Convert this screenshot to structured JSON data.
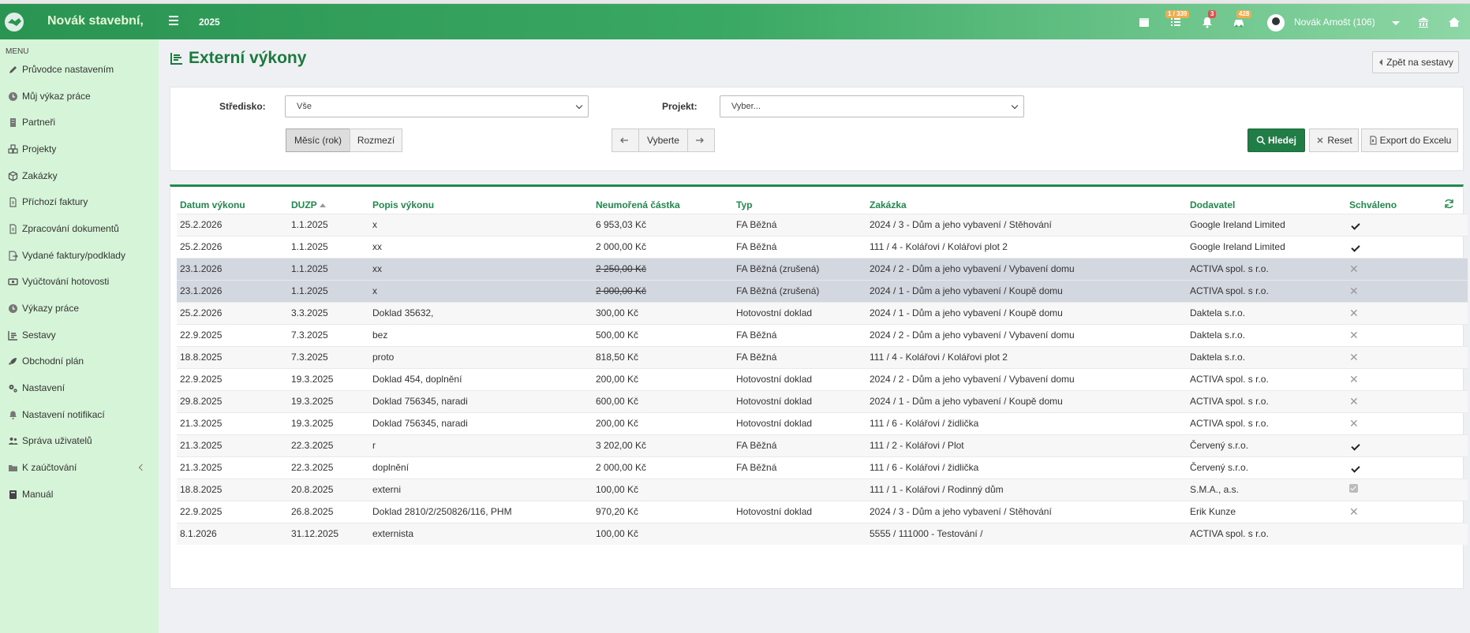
{
  "header": {
    "brand": "Novák stavební,",
    "year": "2025",
    "badges": {
      "tasks": "1 / 339",
      "notifications": "3",
      "cars": "428"
    },
    "user": "Novák Arnošt (106)"
  },
  "sidebar": {
    "menu_title": "MENU",
    "items": [
      {
        "label": "Průvodce nastavením",
        "icon": "pencil-icon"
      },
      {
        "label": "Můj výkaz práce",
        "icon": "clock-icon"
      },
      {
        "label": "Partneři",
        "icon": "building-icon"
      },
      {
        "label": "Projekty",
        "icon": "cubes-icon"
      },
      {
        "label": "Zakázky",
        "icon": "cube-icon"
      },
      {
        "label": "Příchozí faktury",
        "icon": "document-icon"
      },
      {
        "label": "Zpracování dokumentů",
        "icon": "document-icon"
      },
      {
        "label": "Vydané faktury/podklady",
        "icon": "export-icon"
      },
      {
        "label": "Vyúčtování hotovosti",
        "icon": "money-icon"
      },
      {
        "label": "Výkazy práce",
        "icon": "clock-icon"
      },
      {
        "label": "Sestavy",
        "icon": "report-icon"
      },
      {
        "label": "Obchodní plán",
        "icon": "rocket-icon"
      },
      {
        "label": "Nastavení",
        "icon": "gears-icon"
      },
      {
        "label": "Nastavení notifikací",
        "icon": "bell-icon"
      },
      {
        "label": "Správa uživatelů",
        "icon": "users-icon"
      },
      {
        "label": "K zaúčtování",
        "icon": "folder-icon"
      },
      {
        "label": "Manuál",
        "icon": "book-icon"
      }
    ]
  },
  "page": {
    "title": "Externí výkony",
    "back_button": "Zpět na sestavy"
  },
  "filters": {
    "stredisko_label": "Středisko:",
    "stredisko_value": "Vše",
    "projekt_label": "Projekt:",
    "projekt_placeholder": "Vyber...",
    "mode_month": "Měsíc (rok)",
    "mode_range": "Rozmezí",
    "period_select": "Vyberte",
    "search_button": "Hledej",
    "reset_button": "Reset",
    "export_button": "Export do Excelu"
  },
  "table": {
    "columns": [
      "Datum výkonu",
      "DUZP",
      "Popis výkonu",
      "Neumořená částka",
      "Typ",
      "Zakázka",
      "Dodavatel",
      "Schváleno"
    ],
    "rows": [
      {
        "datum": "25.2.2026",
        "duzp": "1.1.2025",
        "popis": "x",
        "castka": "6 953,03 Kč",
        "typ": "FA Běžná",
        "zakazka": "2024 / 3 - Dům a jeho vybavení / Stěhování",
        "dodavatel": "Google Ireland Limited",
        "schvaleno": "check",
        "cancelled": false
      },
      {
        "datum": "25.2.2026",
        "duzp": "1.1.2025",
        "popis": "xx",
        "castka": "2 000,00 Kč",
        "typ": "FA Běžná",
        "zakazka": "111 / 4 - Kolářovi / Kolářovi plot 2",
        "dodavatel": "Google Ireland Limited",
        "schvaleno": "check",
        "cancelled": false
      },
      {
        "datum": "23.1.2026",
        "duzp": "1.1.2025",
        "popis": "xx",
        "castka": "2 250,00 Kč",
        "typ": "FA Běžná (zrušená)",
        "zakazka": "2024 / 2 - Dům a jeho vybavení / Vybavení domu",
        "dodavatel": "ACTIVA spol. s r.o.",
        "schvaleno": "x",
        "cancelled": true
      },
      {
        "datum": "23.1.2026",
        "duzp": "1.1.2025",
        "popis": "x",
        "castka": "2 000,00 Kč",
        "typ": "FA Běžná (zrušená)",
        "zakazka": "2024 / 1 - Dům a jeho vybavení / Koupě domu",
        "dodavatel": "ACTIVA spol. s r.o.",
        "schvaleno": "x",
        "cancelled": true
      },
      {
        "datum": "25.2.2026",
        "duzp": "3.3.2025",
        "popis": "Doklad 35632,",
        "castka": "300,00 Kč",
        "typ": "Hotovostní doklad",
        "zakazka": "2024 / 1 - Dům a jeho vybavení / Koupě domu",
        "dodavatel": "Daktela s.r.o.",
        "schvaleno": "x",
        "cancelled": false
      },
      {
        "datum": "22.9.2025",
        "duzp": "7.3.2025",
        "popis": "bez",
        "castka": "500,00 Kč",
        "typ": "FA Běžná",
        "zakazka": "2024 / 2 - Dům a jeho vybavení / Vybavení domu",
        "dodavatel": "Daktela s.r.o.",
        "schvaleno": "x",
        "cancelled": false
      },
      {
        "datum": "18.8.2025",
        "duzp": "7.3.2025",
        "popis": "proto",
        "castka": "818,50 Kč",
        "typ": "FA Běžná",
        "zakazka": "111 / 4 - Kolářovi / Kolářovi plot 2",
        "dodavatel": "Daktela s.r.o.",
        "schvaleno": "x",
        "cancelled": false
      },
      {
        "datum": "22.9.2025",
        "duzp": "19.3.2025",
        "popis": "Doklad 454, doplnění",
        "castka": "200,00 Kč",
        "typ": "Hotovostní doklad",
        "zakazka": "2024 / 2 - Dům a jeho vybavení / Vybavení domu",
        "dodavatel": "ACTIVA spol. s r.o.",
        "schvaleno": "x",
        "cancelled": false
      },
      {
        "datum": "29.8.2025",
        "duzp": "19.3.2025",
        "popis": "Doklad 756345, naradi",
        "castka": "600,00 Kč",
        "typ": "Hotovostní doklad",
        "zakazka": "2024 / 1 - Dům a jeho vybavení / Koupě domu",
        "dodavatel": "ACTIVA spol. s r.o.",
        "schvaleno": "x",
        "cancelled": false
      },
      {
        "datum": "21.3.2025",
        "duzp": "19.3.2025",
        "popis": "Doklad 756345, naradi",
        "castka": "200,00 Kč",
        "typ": "Hotovostní doklad",
        "zakazka": "111 / 6 - Kolářovi / židlička",
        "dodavatel": "ACTIVA spol. s r.o.",
        "schvaleno": "x",
        "cancelled": false
      },
      {
        "datum": "21.3.2025",
        "duzp": "22.3.2025",
        "popis": "r",
        "castka": "3 202,00 Kč",
        "typ": "FA Běžná",
        "zakazka": "111 / 2 - Kolářovi / Plot",
        "dodavatel": "Červený s.r.o.",
        "schvaleno": "check",
        "cancelled": false
      },
      {
        "datum": "21.3.2025",
        "duzp": "22.3.2025",
        "popis": "doplnění",
        "castka": "2 000,00 Kč",
        "typ": "FA Běžná",
        "zakazka": "111 / 6 - Kolářovi / židlička",
        "dodavatel": "Červený s.r.o.",
        "schvaleno": "check",
        "cancelled": false
      },
      {
        "datum": "18.8.2025",
        "duzp": "20.8.2025",
        "popis": "externi",
        "castka": "100,00 Kč",
        "typ": "",
        "zakazka": "111 / 1 - Kolářovi / Rodinný dům",
        "dodavatel": "S.M.A., a.s.",
        "schvaleno": "box",
        "cancelled": false
      },
      {
        "datum": "22.9.2025",
        "duzp": "26.8.2025",
        "popis": "Doklad 2810/2/250826/116, PHM",
        "castka": "970,20 Kč",
        "typ": "Hotovostní doklad",
        "zakazka": "2024 / 3 - Dům a jeho vybavení / Stěhování",
        "dodavatel": "Erik Kunze",
        "schvaleno": "x",
        "cancelled": false
      },
      {
        "datum": "8.1.2026",
        "duzp": "31.12.2025",
        "popis": "externista",
        "castka": "100,00 Kč",
        "typ": "",
        "zakazka": "5555 / 111000 - Testování /",
        "dodavatel": "ACTIVA spol. s r.o.",
        "schvaleno": "",
        "cancelled": false
      }
    ]
  },
  "colors": {
    "brand_green": "#2a9452",
    "accent_green": "#1f8a4c",
    "sidebar_bg": "#d6f5d8",
    "cancelled_row": "#d3d7e0"
  }
}
